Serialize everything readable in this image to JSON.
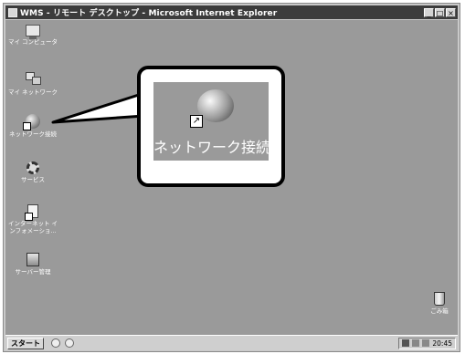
{
  "window": {
    "title": "WMS - リモート デスクトップ - Microsoft Internet Explorer",
    "buttons": {
      "minimize": "_",
      "maximize": "□",
      "close": "×"
    }
  },
  "desktop": {
    "icons": [
      {
        "label": "マイ コンピュータ",
        "icon": "my-computer-icon"
      },
      {
        "label": "マイ ネットワーク",
        "icon": "my-network-icon"
      },
      {
        "label": "ネットワーク接続",
        "icon": "network-connections-icon"
      },
      {
        "label": "サービス",
        "icon": "services-icon"
      },
      {
        "label": "インターネット イ",
        "label2": "ンフォメーショ...",
        "icon": "iis-icon"
      },
      {
        "label": "サーバー管理",
        "icon": "server-management-icon"
      },
      {
        "label": "ごみ箱",
        "icon": "recycle-bin-icon"
      }
    ]
  },
  "callout": {
    "label": "ネットワーク接続",
    "shortcut_glyph": "↗"
  },
  "taskbar": {
    "start_label": "スタート",
    "clock": "20:45"
  }
}
